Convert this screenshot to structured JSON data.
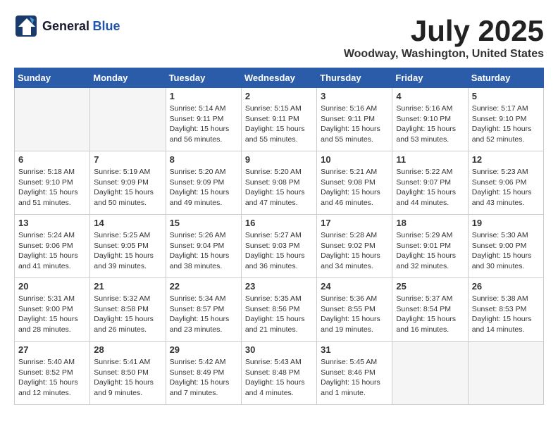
{
  "header": {
    "logo_general": "General",
    "logo_blue": "Blue",
    "month_title": "July 2025",
    "location": "Woodway, Washington, United States"
  },
  "days_of_week": [
    "Sunday",
    "Monday",
    "Tuesday",
    "Wednesday",
    "Thursday",
    "Friday",
    "Saturday"
  ],
  "weeks": [
    [
      {
        "day": "",
        "info": ""
      },
      {
        "day": "",
        "info": ""
      },
      {
        "day": "1",
        "info": "Sunrise: 5:14 AM\nSunset: 9:11 PM\nDaylight: 15 hours and 56 minutes."
      },
      {
        "day": "2",
        "info": "Sunrise: 5:15 AM\nSunset: 9:11 PM\nDaylight: 15 hours and 55 minutes."
      },
      {
        "day": "3",
        "info": "Sunrise: 5:16 AM\nSunset: 9:11 PM\nDaylight: 15 hours and 55 minutes."
      },
      {
        "day": "4",
        "info": "Sunrise: 5:16 AM\nSunset: 9:10 PM\nDaylight: 15 hours and 53 minutes."
      },
      {
        "day": "5",
        "info": "Sunrise: 5:17 AM\nSunset: 9:10 PM\nDaylight: 15 hours and 52 minutes."
      }
    ],
    [
      {
        "day": "6",
        "info": "Sunrise: 5:18 AM\nSunset: 9:10 PM\nDaylight: 15 hours and 51 minutes."
      },
      {
        "day": "7",
        "info": "Sunrise: 5:19 AM\nSunset: 9:09 PM\nDaylight: 15 hours and 50 minutes."
      },
      {
        "day": "8",
        "info": "Sunrise: 5:20 AM\nSunset: 9:09 PM\nDaylight: 15 hours and 49 minutes."
      },
      {
        "day": "9",
        "info": "Sunrise: 5:20 AM\nSunset: 9:08 PM\nDaylight: 15 hours and 47 minutes."
      },
      {
        "day": "10",
        "info": "Sunrise: 5:21 AM\nSunset: 9:08 PM\nDaylight: 15 hours and 46 minutes."
      },
      {
        "day": "11",
        "info": "Sunrise: 5:22 AM\nSunset: 9:07 PM\nDaylight: 15 hours and 44 minutes."
      },
      {
        "day": "12",
        "info": "Sunrise: 5:23 AM\nSunset: 9:06 PM\nDaylight: 15 hours and 43 minutes."
      }
    ],
    [
      {
        "day": "13",
        "info": "Sunrise: 5:24 AM\nSunset: 9:06 PM\nDaylight: 15 hours and 41 minutes."
      },
      {
        "day": "14",
        "info": "Sunrise: 5:25 AM\nSunset: 9:05 PM\nDaylight: 15 hours and 39 minutes."
      },
      {
        "day": "15",
        "info": "Sunrise: 5:26 AM\nSunset: 9:04 PM\nDaylight: 15 hours and 38 minutes."
      },
      {
        "day": "16",
        "info": "Sunrise: 5:27 AM\nSunset: 9:03 PM\nDaylight: 15 hours and 36 minutes."
      },
      {
        "day": "17",
        "info": "Sunrise: 5:28 AM\nSunset: 9:02 PM\nDaylight: 15 hours and 34 minutes."
      },
      {
        "day": "18",
        "info": "Sunrise: 5:29 AM\nSunset: 9:01 PM\nDaylight: 15 hours and 32 minutes."
      },
      {
        "day": "19",
        "info": "Sunrise: 5:30 AM\nSunset: 9:00 PM\nDaylight: 15 hours and 30 minutes."
      }
    ],
    [
      {
        "day": "20",
        "info": "Sunrise: 5:31 AM\nSunset: 9:00 PM\nDaylight: 15 hours and 28 minutes."
      },
      {
        "day": "21",
        "info": "Sunrise: 5:32 AM\nSunset: 8:58 PM\nDaylight: 15 hours and 26 minutes."
      },
      {
        "day": "22",
        "info": "Sunrise: 5:34 AM\nSunset: 8:57 PM\nDaylight: 15 hours and 23 minutes."
      },
      {
        "day": "23",
        "info": "Sunrise: 5:35 AM\nSunset: 8:56 PM\nDaylight: 15 hours and 21 minutes."
      },
      {
        "day": "24",
        "info": "Sunrise: 5:36 AM\nSunset: 8:55 PM\nDaylight: 15 hours and 19 minutes."
      },
      {
        "day": "25",
        "info": "Sunrise: 5:37 AM\nSunset: 8:54 PM\nDaylight: 15 hours and 16 minutes."
      },
      {
        "day": "26",
        "info": "Sunrise: 5:38 AM\nSunset: 8:53 PM\nDaylight: 15 hours and 14 minutes."
      }
    ],
    [
      {
        "day": "27",
        "info": "Sunrise: 5:40 AM\nSunset: 8:52 PM\nDaylight: 15 hours and 12 minutes."
      },
      {
        "day": "28",
        "info": "Sunrise: 5:41 AM\nSunset: 8:50 PM\nDaylight: 15 hours and 9 minutes."
      },
      {
        "day": "29",
        "info": "Sunrise: 5:42 AM\nSunset: 8:49 PM\nDaylight: 15 hours and 7 minutes."
      },
      {
        "day": "30",
        "info": "Sunrise: 5:43 AM\nSunset: 8:48 PM\nDaylight: 15 hours and 4 minutes."
      },
      {
        "day": "31",
        "info": "Sunrise: 5:45 AM\nSunset: 8:46 PM\nDaylight: 15 hours and 1 minute."
      },
      {
        "day": "",
        "info": ""
      },
      {
        "day": "",
        "info": ""
      }
    ]
  ]
}
